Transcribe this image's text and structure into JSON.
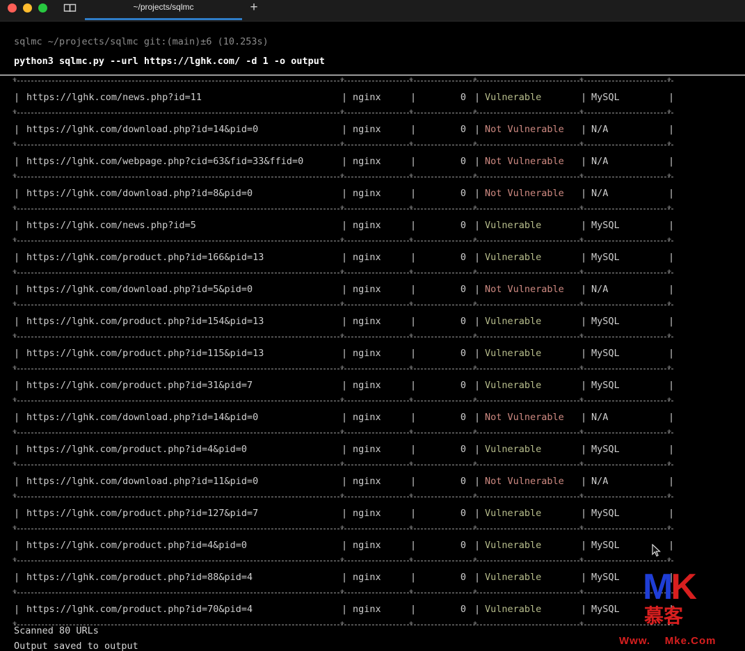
{
  "window": {
    "tab_title": "~/projects/sqlmc",
    "new_tab_label": "+"
  },
  "terminal": {
    "prompt": "sqlmc ~/projects/sqlmc git:(main)±6 (10.253s)",
    "command": "python3 sqlmc.py --url https://lghk.com/ -d 1 -o output",
    "rows": [
      {
        "url": "https://lghk.com/news.php?id=11",
        "server": "nginx",
        "count": "0",
        "status": "Vulnerable",
        "db": "MySQL"
      },
      {
        "url": "https://lghk.com/download.php?id=14&pid=0",
        "server": "nginx",
        "count": "0",
        "status": "Not Vulnerable",
        "db": "N/A"
      },
      {
        "url": "https://lghk.com/webpage.php?cid=63&fid=33&ffid=0",
        "server": "nginx",
        "count": "0",
        "status": "Not Vulnerable",
        "db": "N/A"
      },
      {
        "url": "https://lghk.com/download.php?id=8&pid=0",
        "server": "nginx",
        "count": "0",
        "status": "Not Vulnerable",
        "db": "N/A"
      },
      {
        "url": "https://lghk.com/news.php?id=5",
        "server": "nginx",
        "count": "0",
        "status": "Vulnerable",
        "db": "MySQL"
      },
      {
        "url": "https://lghk.com/product.php?id=166&pid=13",
        "server": "nginx",
        "count": "0",
        "status": "Vulnerable",
        "db": "MySQL"
      },
      {
        "url": "https://lghk.com/download.php?id=5&pid=0",
        "server": "nginx",
        "count": "0",
        "status": "Not Vulnerable",
        "db": "N/A"
      },
      {
        "url": "https://lghk.com/product.php?id=154&pid=13",
        "server": "nginx",
        "count": "0",
        "status": "Vulnerable",
        "db": "MySQL"
      },
      {
        "url": "https://lghk.com/product.php?id=115&pid=13",
        "server": "nginx",
        "count": "0",
        "status": "Vulnerable",
        "db": "MySQL"
      },
      {
        "url": "https://lghk.com/product.php?id=31&pid=7",
        "server": "nginx",
        "count": "0",
        "status": "Vulnerable",
        "db": "MySQL"
      },
      {
        "url": "https://lghk.com/download.php?id=14&pid=0",
        "server": "nginx",
        "count": "0",
        "status": "Not Vulnerable",
        "db": "N/A"
      },
      {
        "url": "https://lghk.com/product.php?id=4&pid=0",
        "server": "nginx",
        "count": "0",
        "status": "Vulnerable",
        "db": "MySQL"
      },
      {
        "url": "https://lghk.com/download.php?id=11&pid=0",
        "server": "nginx",
        "count": "0",
        "status": "Not Vulnerable",
        "db": "N/A"
      },
      {
        "url": "https://lghk.com/product.php?id=127&pid=7",
        "server": "nginx",
        "count": "0",
        "status": "Vulnerable",
        "db": "MySQL"
      },
      {
        "url": "https://lghk.com/product.php?id=4&pid=0",
        "server": "nginx",
        "count": "0",
        "status": "Vulnerable",
        "db": "MySQL"
      },
      {
        "url": "https://lghk.com/product.php?id=88&pid=4",
        "server": "nginx",
        "count": "0",
        "status": "Vulnerable",
        "db": "MySQL"
      },
      {
        "url": "https://lghk.com/product.php?id=70&pid=4",
        "server": "nginx",
        "count": "0",
        "status": "Vulnerable",
        "db": "MySQL"
      }
    ],
    "footer": [
      "Scanned 80 URLs",
      "Output saved to output"
    ]
  },
  "watermark": {
    "logo_m": "M",
    "logo_k": "K",
    "logo_han": "慕客",
    "url": "Www.    Mke.Com"
  },
  "colors": {
    "vulnerable": "#b7bd8c",
    "not_vulnerable": "#cf8a82",
    "tab_accent": "#2f7cc7"
  },
  "icons": [
    "close-light",
    "minimize-light",
    "zoom-light",
    "book-icon",
    "mouse-pointer-icon"
  ]
}
